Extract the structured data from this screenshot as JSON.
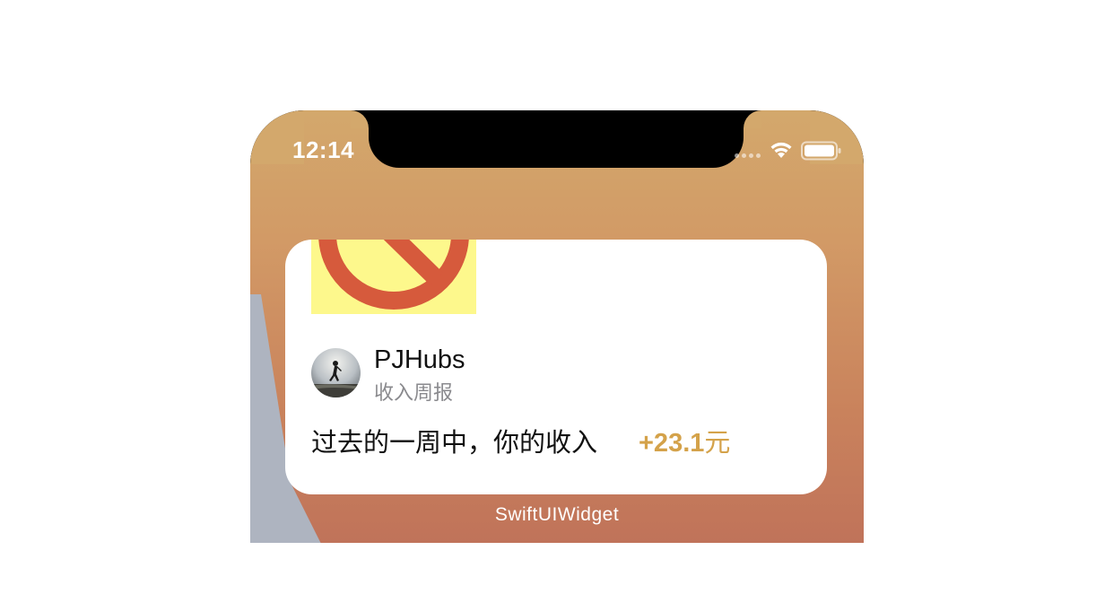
{
  "status_bar": {
    "time": "12:14",
    "wifi_icon": "wifi-icon",
    "battery_icon": "battery-icon"
  },
  "widget": {
    "image_icon": "broken-image-icon",
    "user": {
      "name": "PJHubs",
      "subtitle": "收入周报",
      "avatar_icon": "avatar-runner"
    },
    "message": "过去的一周中，你的收入",
    "amount_value": "+23.1",
    "amount_unit": "元",
    "amount_color": "#d4a24a"
  },
  "widget_caption": "SwiftUIWidget"
}
